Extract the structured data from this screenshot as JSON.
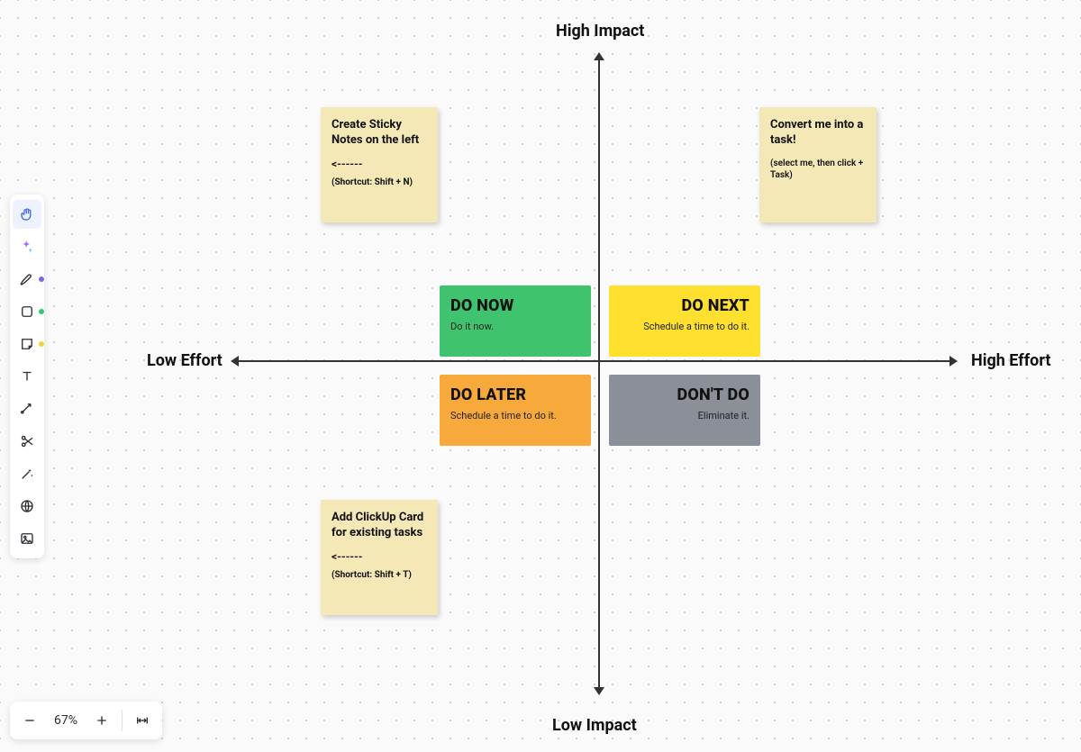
{
  "axes": {
    "top": "High Impact",
    "bottom": "Low Impact",
    "left": "Low Effort",
    "right": "High Effort"
  },
  "quadrants": {
    "do_now": {
      "title": "DO NOW",
      "sub": "Do it now.",
      "color": "#3fc36e"
    },
    "do_next": {
      "title": "DO NEXT",
      "sub": "Schedule a time to do it.",
      "color": "#ffe02e"
    },
    "do_later": {
      "title": "DO LATER",
      "sub": "Schedule a time to do it.",
      "color": "#f7a93b"
    },
    "dont_do": {
      "title": "DON'T DO",
      "sub": "Eliminate it.",
      "color": "#8a8f98"
    }
  },
  "stickies": {
    "create_notes": {
      "title": "Create Sticky Notes on the left",
      "arrow": "<------",
      "hint": "(Shortcut: Shift + N)"
    },
    "convert_task": {
      "title": "Convert me into a task!",
      "hint": "(select me, then click + Task)"
    },
    "add_card": {
      "title": "Add ClickUp Card for existing tasks",
      "arrow": "<------",
      "hint": "(Shortcut: Shift + T)"
    }
  },
  "toolbar": {
    "tools": [
      {
        "name": "hand",
        "active": true
      },
      {
        "name": "ai",
        "active": false
      },
      {
        "name": "pen",
        "active": false,
        "dot": "purple"
      },
      {
        "name": "shape",
        "active": false,
        "dot": "green"
      },
      {
        "name": "sticky",
        "active": false,
        "dot": "yellow"
      },
      {
        "name": "text",
        "active": false
      },
      {
        "name": "connector",
        "active": false
      },
      {
        "name": "embed",
        "active": false
      },
      {
        "name": "magic",
        "active": false
      },
      {
        "name": "web",
        "active": false
      },
      {
        "name": "image",
        "active": false
      }
    ]
  },
  "zoom": {
    "level": "67%"
  }
}
